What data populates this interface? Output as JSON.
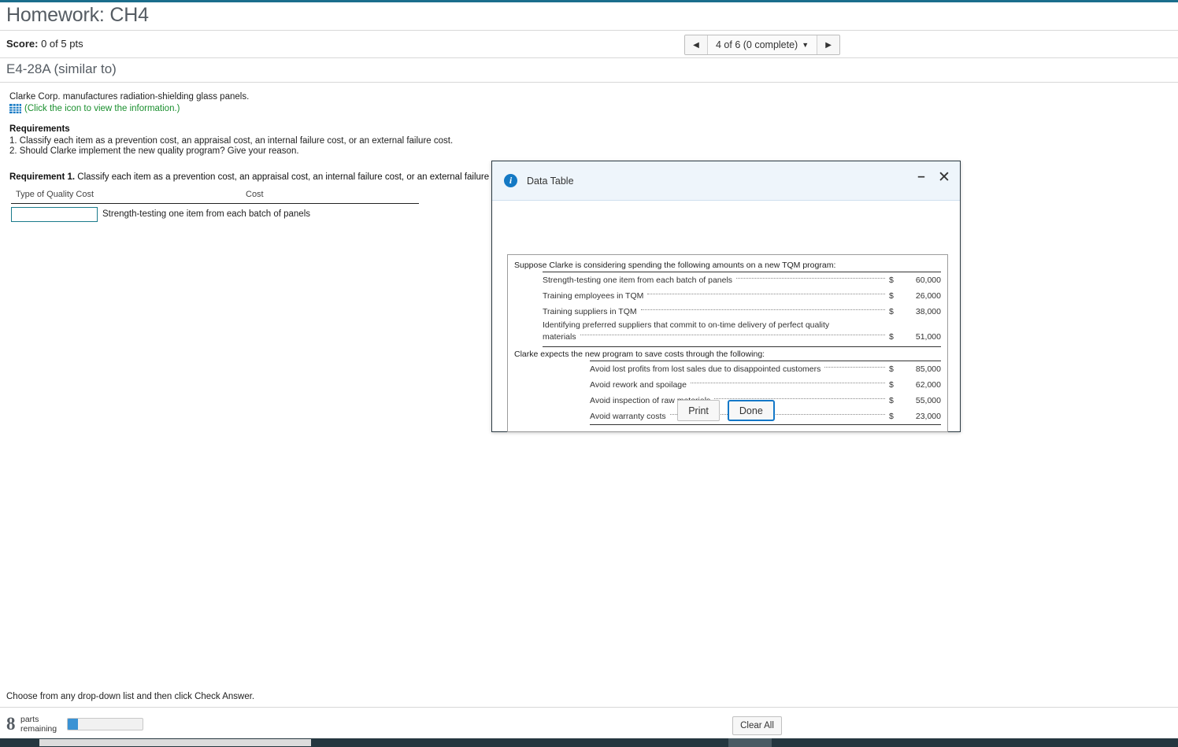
{
  "theme": {
    "accent_teal": "#1b6e8c",
    "link_green": "#1a8f2e",
    "icon_blue": "#1479c4",
    "focus_blue": "#1478c8",
    "progress_blue": "#3a92d4"
  },
  "header": {
    "title": "Homework: CH4",
    "score_label": "Score:",
    "score_value": "0 of 5 pts",
    "exercise_title": "E4-28A (similar to)"
  },
  "pager": {
    "prev_icon": "◀",
    "next_icon": "▶",
    "label": "4 of 6 (0 complete)",
    "caret": "▼"
  },
  "question": {
    "intro": "Clarke Corp. manufactures radiation-shielding glass panels.",
    "icon_name": "data-table-grid-icon",
    "icon_link_text": "(Click the icon to view the information.)",
    "requirements_heading": "Requirements",
    "requirements": [
      "1. Classify each item as a prevention cost, an appraisal cost, an internal failure cost, or an external failure cost.",
      "2. Should Clarke implement the new quality program? Give your reason."
    ],
    "req1_bold": "Requirement 1.",
    "req1_rest": " Classify each item as a prevention cost, an appraisal cost, an internal failure cost, or an external failure cost.",
    "answer_table": {
      "col_type": "Type of Quality Cost",
      "col_cost": "Cost",
      "rows": [
        {
          "selected": "",
          "cost_label": "Strength-testing one item from each batch of panels"
        }
      ]
    }
  },
  "dialog": {
    "title": "Data Table",
    "info_icon_glyph": "i",
    "minimize_glyph": "–",
    "close_glyph": "✕",
    "section1": {
      "caption": "Suppose Clarke is considering spending the following amounts on a new TQM program:",
      "rows": [
        {
          "label": "Strength-testing one item from each batch of panels",
          "currency": "$",
          "value": "60,000"
        },
        {
          "label": "Training employees in TQM",
          "currency": "$",
          "value": "26,000"
        },
        {
          "label": "Training suppliers in TQM",
          "currency": "$",
          "value": "38,000"
        }
      ],
      "wrapped_row": {
        "line1": "Identifying preferred suppliers that commit to on-time delivery of perfect quality",
        "line2": "materials",
        "currency": "$",
        "value": "51,000"
      }
    },
    "section2": {
      "caption": "Clarke expects the new program to save costs through the following:",
      "rows": [
        {
          "label": "Avoid lost profits from lost sales due to disappointed customers",
          "currency": "$",
          "value": "85,000"
        },
        {
          "label": "Avoid rework and spoilage",
          "currency": "$",
          "value": "62,000"
        },
        {
          "label": "Avoid inspection of raw materials",
          "currency": "$",
          "value": "55,000"
        },
        {
          "label": "Avoid warranty costs",
          "currency": "$",
          "value": "23,000"
        }
      ]
    },
    "buttons": {
      "print": "Print",
      "done": "Done"
    }
  },
  "footer": {
    "hint": "Choose from any drop-down list and then click Check Answer.",
    "parts_count": "8",
    "parts_label_line1": "parts",
    "parts_label_line2": "remaining",
    "clear_all": "Clear All"
  }
}
